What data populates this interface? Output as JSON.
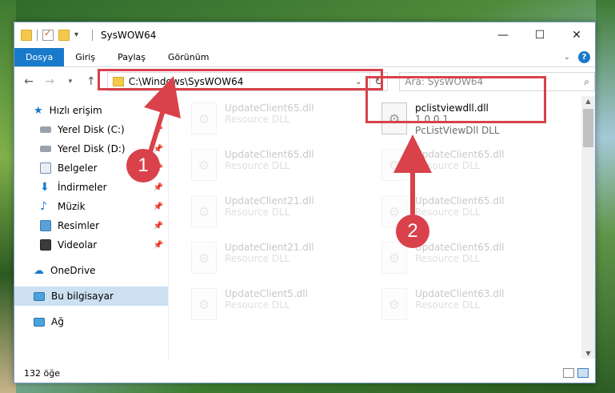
{
  "window": {
    "title": "SysWOW64",
    "controls": [
      "—",
      "☐",
      "✕"
    ]
  },
  "ribbon": {
    "tabs": [
      "Dosya",
      "Giriş",
      "Paylaş",
      "Görünüm"
    ],
    "active_tab": "Dosya"
  },
  "address": {
    "path": "C:\\Windows\\SysWOW64",
    "search_placeholder": "Ara: SysWOW64"
  },
  "nav_pane": {
    "quick_access": "Hızlı erişim",
    "items": [
      {
        "label": "Yerel Disk (C:)",
        "icon": "drive-icon"
      },
      {
        "label": "Yerel Disk (D:)",
        "icon": "drive-icon"
      },
      {
        "label": "Belgeler",
        "icon": "documents-icon"
      },
      {
        "label": "İndirmeler",
        "icon": "downloads-icon"
      },
      {
        "label": "Müzik",
        "icon": "music-icon"
      },
      {
        "label": "Resimler",
        "icon": "pictures-icon"
      },
      {
        "label": "Videolar",
        "icon": "videos-icon"
      }
    ],
    "onedrive": "OneDrive",
    "this_pc": "Bu bilgisayar",
    "network": "Ağ"
  },
  "files": {
    "left_column": [
      {
        "name": "UpdateClient65.dll",
        "meta": "Resource DLL"
      },
      {
        "name": "UpdateClient65.dll",
        "meta": "Resource DLL"
      },
      {
        "name": "UpdateClient21.dll",
        "meta": "Resource DLL"
      },
      {
        "name": "UpdateClient21.dll",
        "meta": "Resource DLL"
      },
      {
        "name": "UpdateClient5.dll",
        "meta": "Resource DLL"
      }
    ],
    "right_column": [
      {
        "name": "pclistviewdll.dll",
        "version": "1.0.0.1",
        "meta": "PcListViewDll DLL"
      },
      {
        "name": "UpdateClient65.dll",
        "meta": "Resource DLL"
      },
      {
        "name": "UpdateClient65.dll",
        "meta": "Resource DLL"
      },
      {
        "name": "UpdateClient65.dll",
        "meta": "Resource DLL"
      },
      {
        "name": "UpdateClient63.dll",
        "meta": "Resource DLL"
      }
    ]
  },
  "status": {
    "count": "132 öğe"
  },
  "annotations": {
    "step1": "1",
    "step2": "2",
    "color": "#d9414b"
  }
}
